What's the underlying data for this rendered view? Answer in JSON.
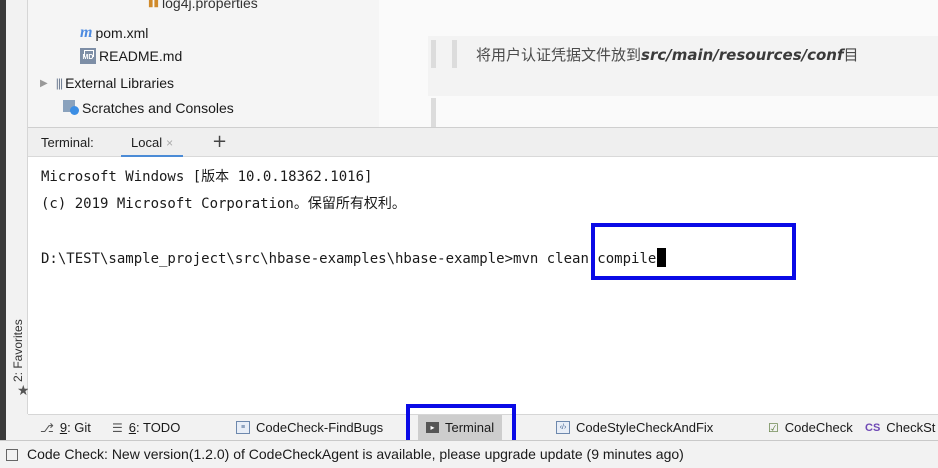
{
  "favorites": {
    "label": "2: Favorites"
  },
  "project_tree": {
    "partial_top": "log4j.properties",
    "items": [
      {
        "label": "pom.xml",
        "icon": "maven-m-icon"
      },
      {
        "label": "README.md",
        "icon": "markdown-icon"
      },
      {
        "label": "External Libraries",
        "icon": "library-icon"
      },
      {
        "label": "Scratches and Consoles",
        "icon": "scratch-icon"
      }
    ]
  },
  "editor": {
    "partial_top": "",
    "quote_prefix": "将用户认证凭据文件放到",
    "quote_path": "src/main/resources/conf",
    "quote_suffix": "目"
  },
  "terminal": {
    "title": "Terminal:",
    "tab_label": "Local",
    "add_tab": "+",
    "lines": [
      "Microsoft Windows [版本 10.0.18362.1016]",
      "(c) 2019 Microsoft Corporation。保留所有权利。"
    ],
    "prompt": "D:\\TEST\\sample_project\\src\\hbase-examples\\hbase-example>",
    "command": "mvn clean compile"
  },
  "tool_windows": [
    {
      "prefix": "",
      "mnemonic": "9",
      "label": ": Git"
    },
    {
      "prefix": "",
      "mnemonic": "6",
      "label": ": TODO"
    },
    {
      "label": "CodeCheck-FindBugs"
    },
    {
      "label": "Terminal"
    },
    {
      "label": "CodeStyleCheckAndFix"
    },
    {
      "label": "CodeCheck"
    },
    {
      "label": "CheckSt"
    }
  ],
  "status": {
    "message": "Code Check: New version(1.2.0) of CodeCheckAgent is available, please upgrade update (9 minutes ago)"
  },
  "colors": {
    "highlight": "#0a0ae6",
    "tab_underline": "#4b8bd6"
  }
}
